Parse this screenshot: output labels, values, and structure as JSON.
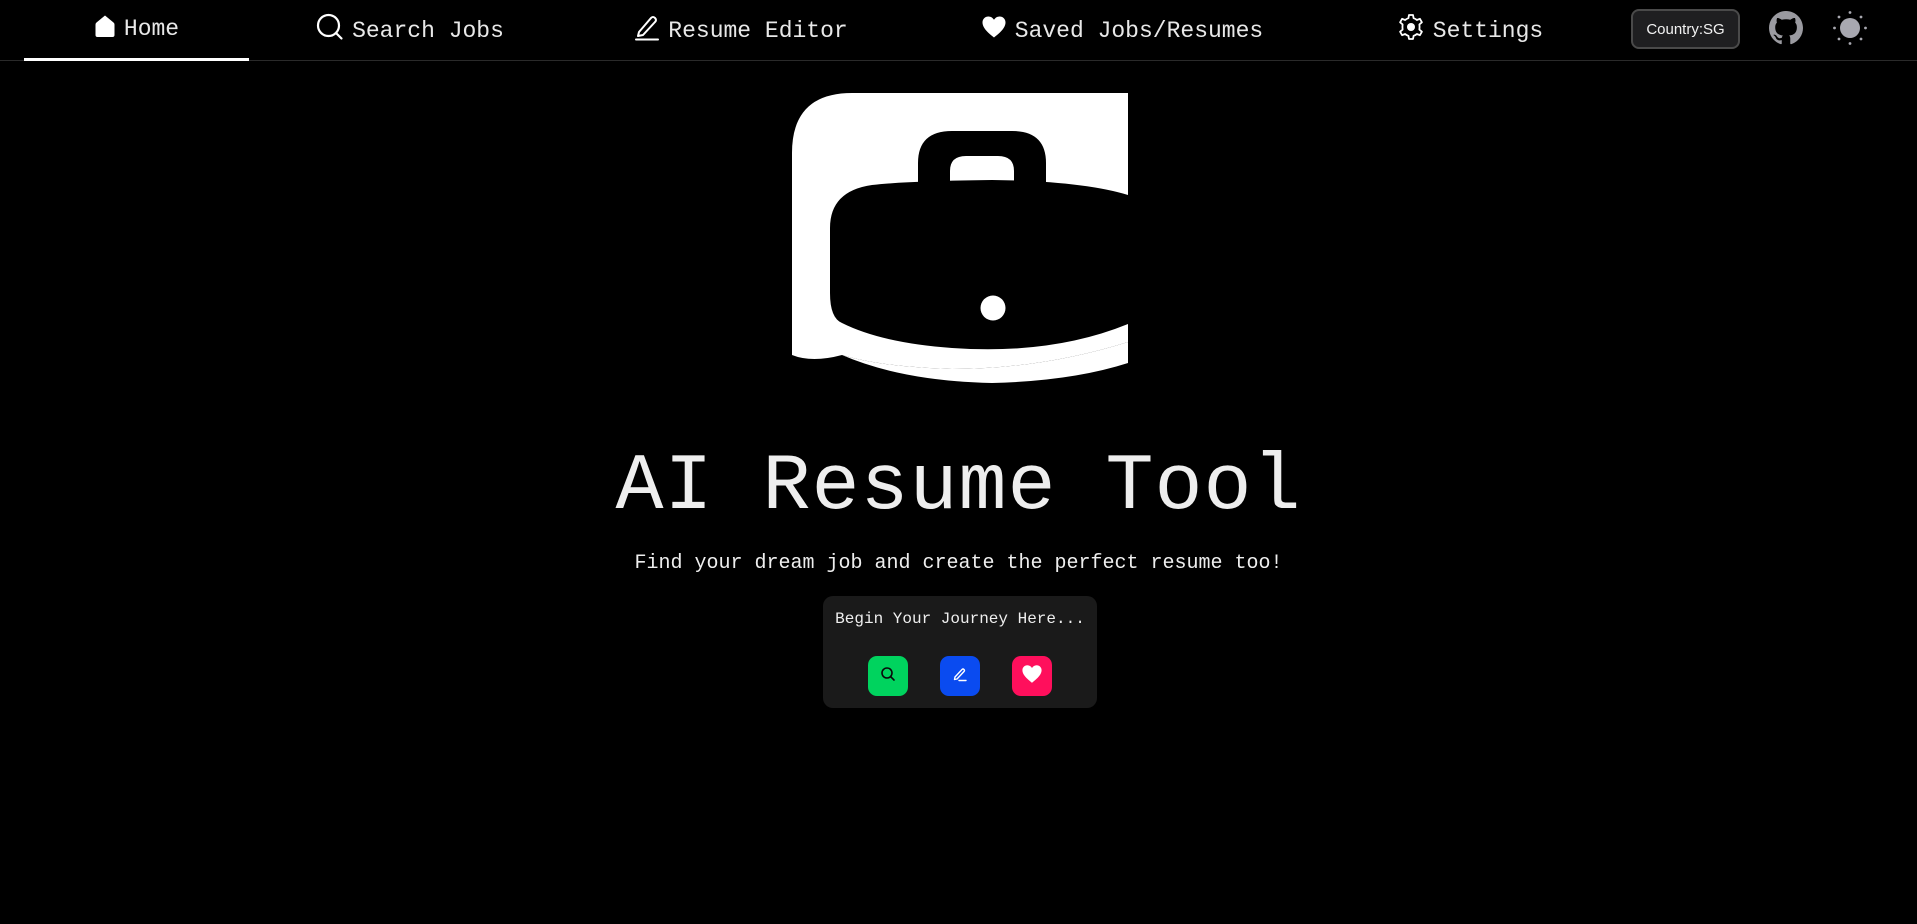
{
  "nav": {
    "tabs": [
      {
        "label": "Home",
        "icon": "home-icon",
        "active": true
      },
      {
        "label": "Search Jobs",
        "icon": "search-icon",
        "active": false
      },
      {
        "label": "Resume Editor",
        "icon": "pencil-icon",
        "active": false
      },
      {
        "label": "Saved Jobs/Resumes",
        "icon": "heart-icon",
        "active": false
      },
      {
        "label": "Settings",
        "icon": "gear-icon",
        "active": false
      }
    ],
    "country_label": "Country:SG",
    "github_icon": "github-icon",
    "theme_icon": "sun-icon"
  },
  "hero": {
    "logo_icon": "briefcase-logo-icon",
    "title": "AI Resume Tool",
    "subtitle": "Find your dream job and create the perfect resume too!"
  },
  "journey": {
    "label": "Begin Your Journey Here...",
    "actions": [
      {
        "name": "search",
        "icon": "search-icon",
        "color": "#00d35e"
      },
      {
        "name": "edit",
        "icon": "pencil-icon",
        "color": "#0a4bf0"
      },
      {
        "name": "saved",
        "icon": "heart-icon",
        "color": "#ff0f5c"
      }
    ]
  },
  "colors": {
    "background": "#000000",
    "text": "#eeeeee",
    "card": "#1a1a1a"
  }
}
